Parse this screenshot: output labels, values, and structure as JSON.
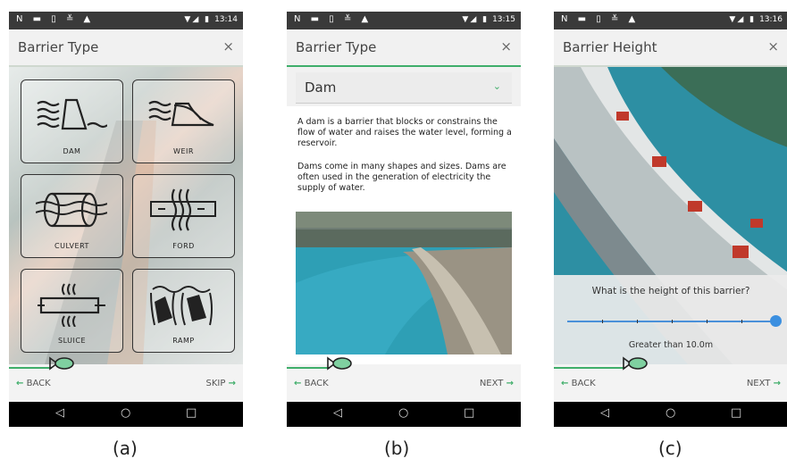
{
  "status": {
    "time_a": "13:14",
    "time_b": "13:15",
    "time_c": "13:16"
  },
  "screen_a": {
    "title": "Barrier Type",
    "close": "×",
    "tiles": [
      {
        "label": "DAM",
        "icon": "dam-icon"
      },
      {
        "label": "WEIR",
        "icon": "weir-icon"
      },
      {
        "label": "CULVERT",
        "icon": "culvert-icon"
      },
      {
        "label": "FORD",
        "icon": "ford-icon"
      },
      {
        "label": "SLUICE",
        "icon": "sluice-icon"
      },
      {
        "label": "RAMP",
        "icon": "ramp-icon"
      }
    ],
    "back": "BACK",
    "forward": "SKIP",
    "caption": "(a)"
  },
  "screen_b": {
    "title": "Barrier Type",
    "close": "×",
    "selected": "Dam",
    "para1": "A dam is a barrier that blocks or constrains the flow of water and raises the water level, forming a reservoir.",
    "para2": "Dams come in many shapes and sizes. Dams are often used in the generation of electricity the supply of water.",
    "back": "BACK",
    "forward": "NEXT",
    "caption": "(b)"
  },
  "screen_c": {
    "title": "Barrier Height",
    "close": "×",
    "question": "What is the height of this barrier?",
    "slider_value_label": "Greater than 10.0m",
    "slider_fraction": 1.0,
    "back": "BACK",
    "forward": "NEXT",
    "caption": "(c)"
  },
  "colors": {
    "accent": "#3fae6a",
    "slider": "#3b8fe0"
  }
}
